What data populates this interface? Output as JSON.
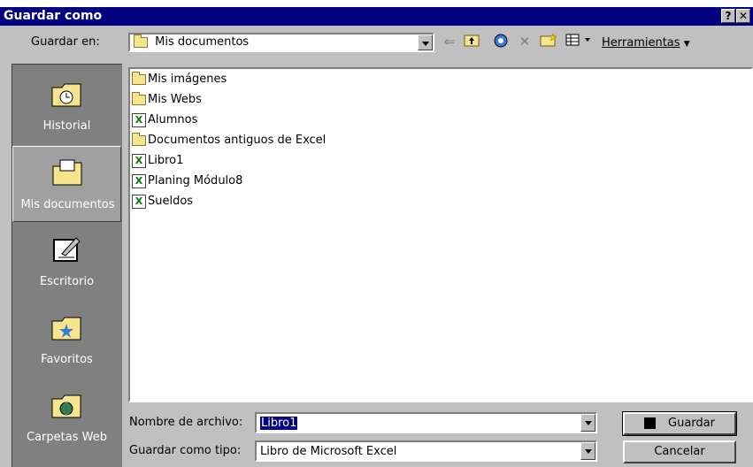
{
  "window": {
    "title": "Guardar como",
    "help_label": "?",
    "close_label": "✕"
  },
  "toolbar": {
    "save_in_label": "Guardar en:",
    "save_in_value": "Mis documentos",
    "back_icon": "back-arrow-icon",
    "up_icon": "up-folder-icon",
    "search_web_icon": "search-web-icon",
    "delete_icon": "delete-icon",
    "new_folder_icon": "new-folder-icon",
    "views_icon": "views-icon",
    "tools_label": "Herramientas"
  },
  "places": [
    {
      "label": "Historial",
      "icon": "history-folder-icon"
    },
    {
      "label": "Mis documentos",
      "icon": "my-documents-folder-icon"
    },
    {
      "label": "Escritorio",
      "icon": "desktop-icon"
    },
    {
      "label": "Favoritos",
      "icon": "favorites-folder-icon"
    },
    {
      "label": "Carpetas Web",
      "icon": "web-folders-icon"
    }
  ],
  "files": [
    {
      "name": "Mis imágenes",
      "type": "folder"
    },
    {
      "name": "Mis Webs",
      "type": "folder"
    },
    {
      "name": "Alumnos",
      "type": "excel"
    },
    {
      "name": "Documentos antiguos de Excel",
      "type": "folder-shortcut"
    },
    {
      "name": "Libro1",
      "type": "excel"
    },
    {
      "name": "Planing Módulo8",
      "type": "excel"
    },
    {
      "name": "Sueldos",
      "type": "excel"
    }
  ],
  "footer": {
    "filename_label": "Nombre de archivo:",
    "filename_value": "Libro1",
    "filetype_label": "Guardar como tipo:",
    "filetype_value": "Libro de Microsoft Excel",
    "save_button": "Guardar",
    "cancel_button": "Cancelar"
  },
  "colors": {
    "titlebar": "#000080",
    "dialog": "#c0c0c0",
    "places_bar": "#808080"
  }
}
